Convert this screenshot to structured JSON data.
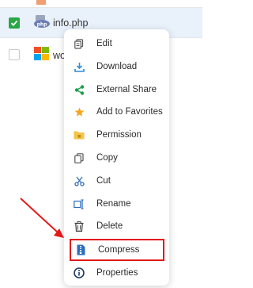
{
  "files": [
    {
      "name": "info.php",
      "checked": true,
      "icon": "php-file-icon"
    },
    {
      "name": "wor",
      "checked": false,
      "icon": "wordpress-folder-icon"
    }
  ],
  "context_menu": {
    "items": [
      {
        "label": "Edit",
        "icon": "edit-icon"
      },
      {
        "label": "Download",
        "icon": "download-icon"
      },
      {
        "label": "External Share",
        "icon": "share-icon"
      },
      {
        "label": "Add to Favorites",
        "icon": "star-icon"
      },
      {
        "label": "Permission",
        "icon": "permission-folder-icon"
      },
      {
        "label": "Copy",
        "icon": "copy-icon"
      },
      {
        "label": "Cut",
        "icon": "scissors-icon"
      },
      {
        "label": "Rename",
        "icon": "rename-icon"
      },
      {
        "label": "Delete",
        "icon": "trash-icon"
      },
      {
        "label": "Compress",
        "icon": "archive-icon",
        "highlighted": true
      },
      {
        "label": "Properties",
        "icon": "info-icon"
      }
    ]
  },
  "colors": {
    "selected_row": "#e9f1fb",
    "checkbox_checked": "#28a745",
    "highlight_border": "#e31a1a",
    "arrow": "#e31a1a"
  }
}
